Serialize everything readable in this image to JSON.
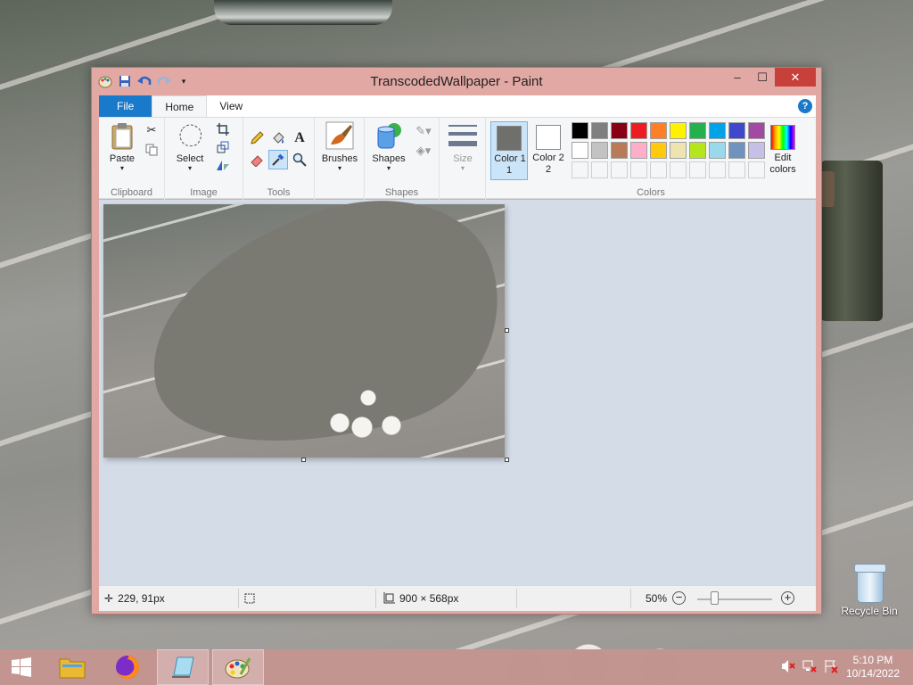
{
  "window": {
    "title": "TranscodedWallpaper - Paint",
    "controls": {
      "minimize": "–",
      "maximize": "☐",
      "close": "✕"
    }
  },
  "ribbon": {
    "tabs": [
      "File",
      "Home",
      "View"
    ],
    "help": "?",
    "clipboard": {
      "paste": "Paste",
      "label": "Clipboard"
    },
    "image": {
      "select": "Select",
      "label": "Image"
    },
    "tools": {
      "label": "Tools"
    },
    "brushes": {
      "label": "Brushes"
    },
    "shapes": {
      "button": "Shapes",
      "label": "Shapes"
    },
    "size": {
      "label": "Size"
    },
    "colors": {
      "color1": "Color 1",
      "color1_num": "1",
      "color2": "Color 2",
      "color2_num": "2",
      "edit": "Edit colors",
      "label": "Colors",
      "color1_value": "#6f706c",
      "color2_value": "#ffffff",
      "palette_row1": [
        "#000000",
        "#7f7f7f",
        "#880015",
        "#ed1c24",
        "#ff7f27",
        "#fff200",
        "#22b14c",
        "#00a2e8",
        "#3f48cc",
        "#a349a4"
      ],
      "palette_row2": [
        "#ffffff",
        "#c3c3c3",
        "#b97a57",
        "#ffaec9",
        "#ffc90e",
        "#efe4b0",
        "#b5e61d",
        "#99d9ea",
        "#7092be",
        "#c8bfe7"
      ]
    }
  },
  "status": {
    "cursor_pos": "229, 91px",
    "image_size": "900 × 568px",
    "zoom": "50%"
  },
  "desktop": {
    "recycle_bin": "Recycle Bin"
  },
  "taskbar": {
    "time": "5:10 PM",
    "date": "10/14/2022"
  }
}
